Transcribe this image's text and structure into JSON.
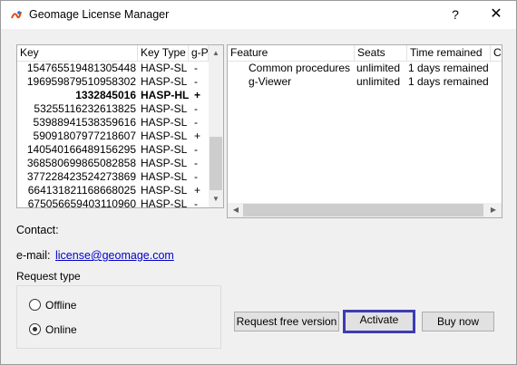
{
  "window": {
    "title": "Geomage License Manager"
  },
  "title_buttons": {
    "help": "?",
    "close": "✕"
  },
  "key_table": {
    "columns": [
      "Key",
      "Key Type",
      "g-P"
    ],
    "rows": [
      {
        "key": "154765519481305448",
        "type": "HASP-SL",
        "gp": "-",
        "bold": false
      },
      {
        "key": "196959879510958302",
        "type": "HASP-SL",
        "gp": "-",
        "bold": false
      },
      {
        "key": "1332845016",
        "type": "HASP-HL",
        "gp": "+",
        "bold": true
      },
      {
        "key": "53255116232613825",
        "type": "HASP-SL",
        "gp": "-",
        "bold": false
      },
      {
        "key": "53988941538359616",
        "type": "HASP-SL",
        "gp": "-",
        "bold": false
      },
      {
        "key": "59091807977218607",
        "type": "HASP-SL",
        "gp": "+",
        "bold": false
      },
      {
        "key": "140540166489156295",
        "type": "HASP-SL",
        "gp": "-",
        "bold": false
      },
      {
        "key": "368580699865082858",
        "type": "HASP-SL",
        "gp": "-",
        "bold": false
      },
      {
        "key": "377228423524273869",
        "type": "HASP-SL",
        "gp": "-",
        "bold": false
      },
      {
        "key": "664131821168668025",
        "type": "HASP-SL",
        "gp": "+",
        "bold": false
      },
      {
        "key": "675056659403110960",
        "type": "HASP-SL",
        "gp": "-",
        "bold": false
      }
    ]
  },
  "feature_table": {
    "columns": [
      "Feature",
      "Seats",
      "Time remained",
      "CF"
    ],
    "rows": [
      {
        "feature": "Common procedures",
        "seats": "unlimited",
        "time": "1 days remained"
      },
      {
        "feature": "g-Viewer",
        "seats": "unlimited",
        "time": "1 days remained"
      }
    ]
  },
  "contact": {
    "label": "Contact:",
    "email_label": "e-mail:",
    "email": "license@geomage.com"
  },
  "request_type": {
    "title": "Request type",
    "options": [
      "Offline",
      "Online"
    ],
    "selected": "Online"
  },
  "buttons": {
    "request_free": "Request free version",
    "activate": "Activate",
    "buy_now": "Buy now"
  },
  "colors": {
    "focus_border": "#3c3cb4",
    "link": "#0000cc"
  }
}
